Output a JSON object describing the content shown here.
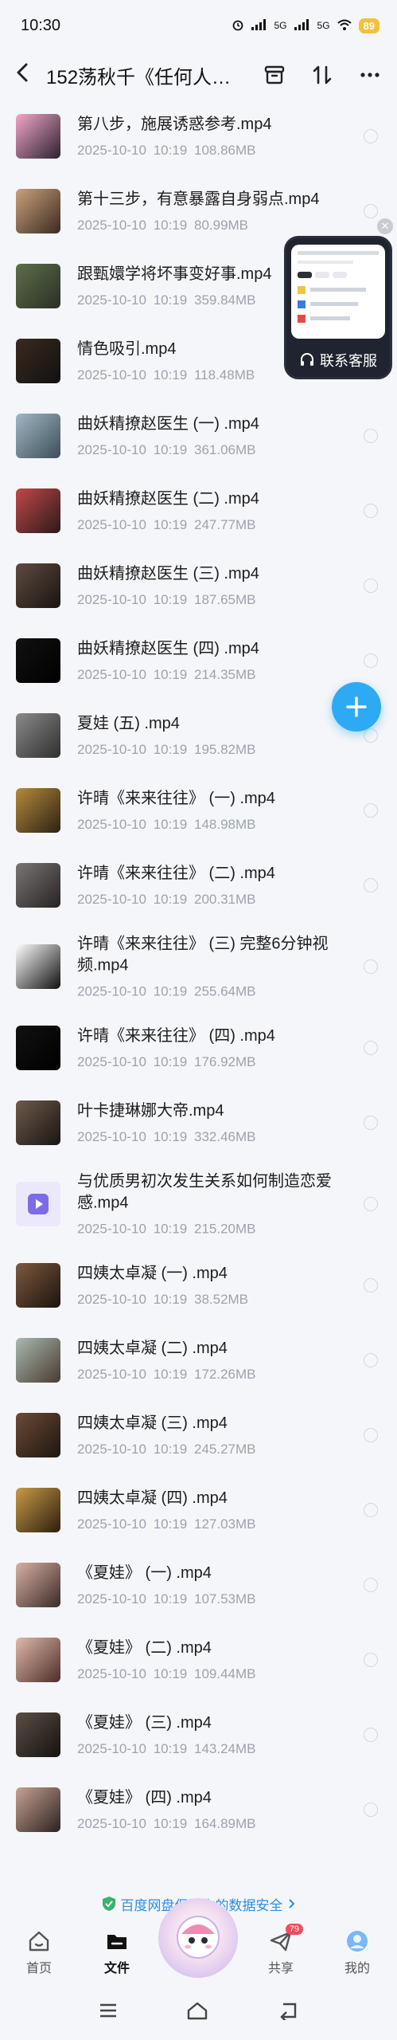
{
  "status_bar": {
    "time": "10:30",
    "signal1": "5G",
    "signal2": "5G",
    "battery": "89"
  },
  "nav": {
    "title": "152荡秋千《任何人…"
  },
  "files": [
    {
      "name": "第八步，施展诱惑参考.mp4",
      "date": "2025-10-10",
      "time": "10:19",
      "size": "108.86MB",
      "thumb": "pink"
    },
    {
      "name": "第十三步，有意暴露自身弱点.mp4",
      "date": "2025-10-10",
      "time": "10:19",
      "size": "80.99MB",
      "thumb": "warm"
    },
    {
      "name": "跟甄嬛学将坏事变好事.mp4",
      "date": "2025-10-10",
      "time": "10:19",
      "size": "359.84MB",
      "thumb": "green"
    },
    {
      "name": "情色吸引.mp4",
      "date": "2025-10-10",
      "time": "10:19",
      "size": "118.48MB",
      "thumb": "dark"
    },
    {
      "name": "曲妖精撩赵医生 (一) .mp4",
      "date": "2025-10-10",
      "time": "10:19",
      "size": "361.06MB",
      "thumb": "clinic"
    },
    {
      "name": "曲妖精撩赵医生 (二) .mp4",
      "date": "2025-10-10",
      "time": "10:19",
      "size": "247.77MB",
      "thumb": "red"
    },
    {
      "name": "曲妖精撩赵医生 (三) .mp4",
      "date": "2025-10-10",
      "time": "10:19",
      "size": "187.65MB",
      "thumb": "dark2"
    },
    {
      "name": "曲妖精撩赵医生 (四) .mp4",
      "date": "2025-10-10",
      "time": "10:19",
      "size": "214.35MB",
      "thumb": "black"
    },
    {
      "name": "夏娃 (五) .mp4",
      "date": "2025-10-10",
      "time": "10:19",
      "size": "195.82MB",
      "thumb": "grey"
    },
    {
      "name": "许晴《来来往往》 (一) .mp4",
      "date": "2025-10-10",
      "time": "10:19",
      "size": "148.98MB",
      "thumb": "amber"
    },
    {
      "name": "许晴《来来往往》 (二) .mp4",
      "date": "2025-10-10",
      "time": "10:19",
      "size": "200.31MB",
      "thumb": "grey2"
    },
    {
      "name": "许晴《来来往往》 (三) 完整6分钟视频.mp4",
      "date": "2025-10-10",
      "time": "10:19",
      "size": "255.64MB",
      "thumb": "card",
      "two_line": true
    },
    {
      "name": "许晴《来来往往》 (四) .mp4",
      "date": "2025-10-10",
      "time": "10:19",
      "size": "176.92MB",
      "thumb": "black"
    },
    {
      "name": "叶卡捷琳娜大帝.mp4",
      "date": "2025-10-10",
      "time": "10:19",
      "size": "332.46MB",
      "thumb": "dark3"
    },
    {
      "name": "与优质男初次发生关系如何制造恋爱感.mp4",
      "date": "2025-10-10",
      "time": "10:19",
      "size": "215.20MB",
      "thumb": "video",
      "two_line": true
    },
    {
      "name": "四姨太卓凝 (一) .mp4",
      "date": "2025-10-10",
      "time": "10:19",
      "size": "38.52MB",
      "thumb": "brown"
    },
    {
      "name": "四姨太卓凝 (二) .mp4",
      "date": "2025-10-10",
      "time": "10:19",
      "size": "172.26MB",
      "thumb": "clinic2"
    },
    {
      "name": "四姨太卓凝 (三) .mp4",
      "date": "2025-10-10",
      "time": "10:19",
      "size": "245.27MB",
      "thumb": "brown2"
    },
    {
      "name": "四姨太卓凝 (四) .mp4",
      "date": "2025-10-10",
      "time": "10:19",
      "size": "127.03MB",
      "thumb": "gold"
    },
    {
      "name": "《夏娃》 (一) .mp4",
      "date": "2025-10-10",
      "time": "10:19",
      "size": "107.53MB",
      "thumb": "face"
    },
    {
      "name": "《夏娃》 (二) .mp4",
      "date": "2025-10-10",
      "time": "10:19",
      "size": "109.44MB",
      "thumb": "face2"
    },
    {
      "name": "《夏娃》 (三) .mp4",
      "date": "2025-10-10",
      "time": "10:19",
      "size": "143.24MB",
      "thumb": "dark4"
    },
    {
      "name": "《夏娃》 (四) .mp4",
      "date": "2025-10-10",
      "time": "10:19",
      "size": "164.89MB",
      "thumb": "face3"
    }
  ],
  "thumb_colors": {
    "pink": [
      "#f4a6c8",
      "#2a2230"
    ],
    "warm": [
      "#c9a27a",
      "#3b2a22"
    ],
    "green": [
      "#5c6f4a",
      "#2b2f26"
    ],
    "dark": [
      "#3a2a1e",
      "#111"
    ],
    "clinic": [
      "#9fb7c4",
      "#3d4f58"
    ],
    "red": [
      "#c24848",
      "#2a1a1a"
    ],
    "dark2": [
      "#5e4b40",
      "#1a1412"
    ],
    "black": [
      "#111111",
      "#000000"
    ],
    "grey": [
      "#8a8a8a",
      "#2f2f2f"
    ],
    "amber": [
      "#b58a3a",
      "#2c2214"
    ],
    "grey2": [
      "#7a7574",
      "#262322"
    ],
    "card": [
      "#ffffff",
      "#101010"
    ],
    "dark3": [
      "#6e5a4b",
      "#191513"
    ],
    "video": [
      "#ebe8fb",
      "#ebe8fb"
    ],
    "brown": [
      "#7e5a3f",
      "#1c130d"
    ],
    "clinic2": [
      "#a8b9b0",
      "#4a3b30"
    ],
    "brown2": [
      "#6c4a36",
      "#1e1510"
    ],
    "gold": [
      "#c99a45",
      "#2b1e10"
    ],
    "face": [
      "#d8b1a4",
      "#3a2a26"
    ],
    "face2": [
      "#e0b8a8",
      "#4a2f2a"
    ],
    "dark4": [
      "#5a4f46",
      "#16120f"
    ],
    "face3": [
      "#c7a292",
      "#2b2220"
    ]
  },
  "service": {
    "label": "联系客服"
  },
  "safety_banner": {
    "text": "百度网盘保障你的数据安全",
    "color": "#2b8ee6"
  },
  "tabs": [
    {
      "label": "首页",
      "icon": "home-icon"
    },
    {
      "label": "文件",
      "icon": "folder-icon",
      "active": true
    },
    {
      "label": "",
      "icon": "mascot-icon"
    },
    {
      "label": "共享",
      "icon": "share-icon",
      "badge": "79"
    },
    {
      "label": "我的",
      "icon": "profile-icon"
    }
  ],
  "accent_color": "#2eaaf5"
}
